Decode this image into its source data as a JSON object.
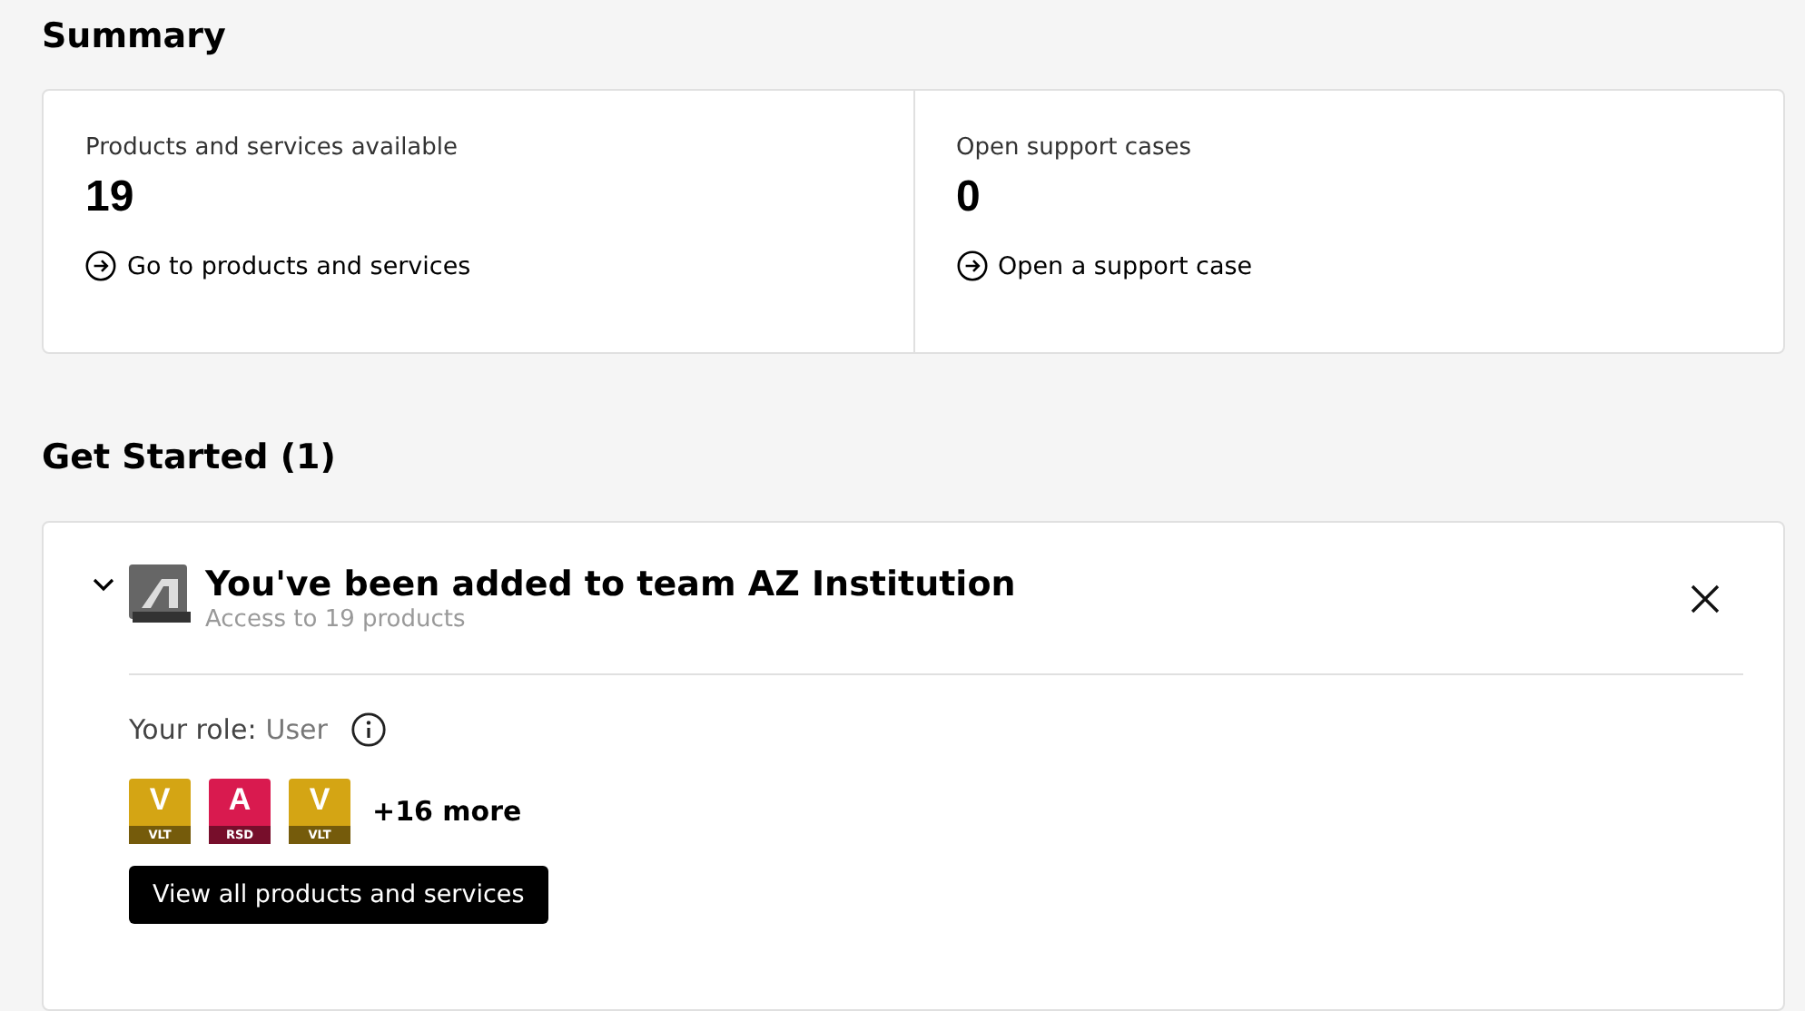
{
  "summary": {
    "title": "Summary",
    "stats": [
      {
        "label": "Products and services available",
        "value": "19",
        "link": "Go to products and services"
      },
      {
        "label": "Open support cases",
        "value": "0",
        "link": "Open a support case"
      }
    ]
  },
  "get_started": {
    "title": "Get Started (1)",
    "card": {
      "expanded": true,
      "title": "You've been added to team AZ Institution",
      "subtitle": "Access to 19 products",
      "role_label": "Your role:",
      "role": "User",
      "products": [
        {
          "letter": "V",
          "code": "VLT",
          "color": "#d4a514"
        },
        {
          "letter": "A",
          "code": "RSD",
          "color": "#d91a4f"
        },
        {
          "letter": "V",
          "code": "VLT",
          "color": "#d4a514"
        }
      ],
      "more": "+16 more",
      "button": "View all products and services"
    }
  }
}
